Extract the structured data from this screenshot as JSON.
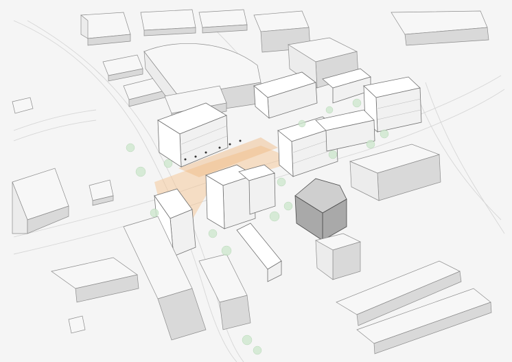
{
  "image": {
    "kind": "axonometric urban massing diagram",
    "colors": {
      "background": "#ffffff",
      "context_building": "#ececec",
      "new_building": "#ffffff",
      "highlight_plaza": "#f4c89a",
      "trees": "#cfe8cf",
      "dark_building": "#a9a9a9"
    }
  }
}
